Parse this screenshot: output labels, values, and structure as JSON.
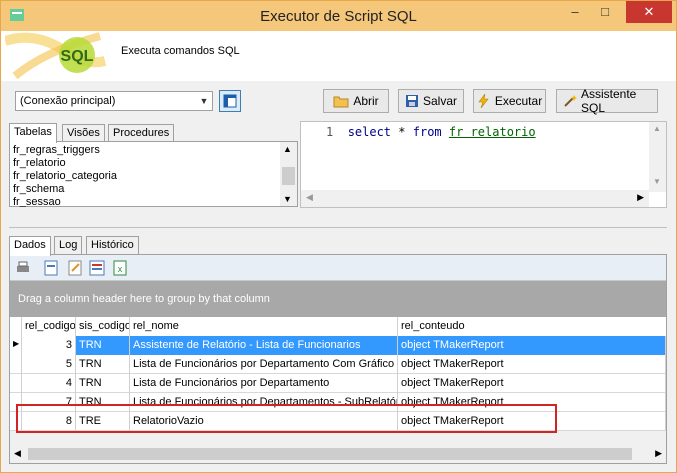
{
  "window": {
    "title": "Executor de Script SQL",
    "minimize": "–",
    "maximize": "□",
    "close": "✕"
  },
  "header": {
    "logo_text": "SQL",
    "description": "Executa comandos SQL"
  },
  "toolbar": {
    "connection": "(Conexão principal)",
    "abrir": "Abrir",
    "salvar": "Salvar",
    "executar": "Executar",
    "assistente": "Assistente SQL"
  },
  "left_tabs": [
    "Tabelas",
    "Visões",
    "Procedures"
  ],
  "tables": [
    "fr_regras_triggers",
    "fr_relatorio",
    "fr_relatorio_categoria",
    "fr_schema",
    "fr_sessao"
  ],
  "editor": {
    "line_number": "1",
    "kw1": "select",
    "star": "*",
    "kw2": "from",
    "table": "fr relatorio"
  },
  "bottom_tabs": [
    "Dados",
    "Log",
    "Histórico"
  ],
  "grid": {
    "group_hint": "Drag a column header here to group by that column",
    "columns": [
      "rel_codigo",
      "sis_codigo",
      "rel_nome",
      "rel_conteudo"
    ],
    "rows": [
      [
        "3",
        "TRN",
        "Assistente de Relatório - Lista de Funcionarios",
        "object TMakerReport"
      ],
      [
        "5",
        "TRN",
        "Lista de Funcionários por Departamento Com Gráfico",
        "object TMakerReport"
      ],
      [
        "4",
        "TRN",
        "Lista de Funcionários por Departamento",
        "object TMakerReport"
      ],
      [
        "7",
        "TRN",
        "Lista de Funcionários por Departamentos - SubRelatório",
        "object TMakerReport"
      ],
      [
        "8",
        "TRE",
        "RelatorioVazio",
        "object TMakerReport"
      ]
    ]
  },
  "colors": {
    "selection": "#3399ff",
    "highlight_box": "#d32424",
    "title_bar": "#f5c77a"
  }
}
